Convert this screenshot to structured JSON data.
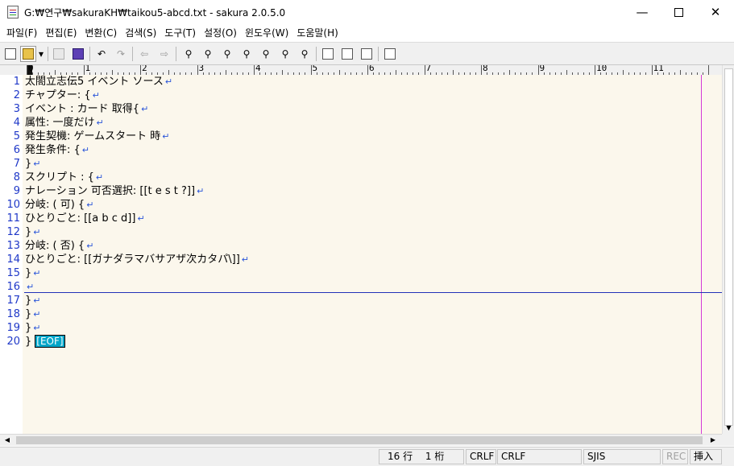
{
  "window": {
    "title": "G:₩연구₩sakuraKH₩taikou5-abcd.txt - sakura 2.0.5.0",
    "minimize": "—",
    "close": "✕"
  },
  "menu": [
    {
      "label": "파일(F)"
    },
    {
      "label": "편집(E)"
    },
    {
      "label": "변환(C)"
    },
    {
      "label": "검색(S)"
    },
    {
      "label": "도구(T)"
    },
    {
      "label": "설정(O)"
    },
    {
      "label": "윈도우(W)"
    },
    {
      "label": "도움말(H)"
    }
  ],
  "toolbar": {
    "icons": [
      "new-file-icon",
      "open-file-icon",
      "dropdown-arrow-icon",
      "save-disabled-icon",
      "save-as-icon",
      "undo-icon",
      "redo-icon",
      "jump-back-icon",
      "jump-forward-icon",
      "search-icon",
      "search-prev-icon",
      "search-next-icon",
      "replace-icon",
      "clear-search-mark-icon",
      "grep-icon",
      "tag-jump-icon",
      "compare-icon",
      "outline-icon",
      "print-icon",
      "properties-icon"
    ]
  },
  "ruler": {
    "labels": [
      "0",
      "1",
      "2",
      "3",
      "4",
      "5",
      "6",
      "7",
      "8",
      "9",
      "10",
      "11"
    ]
  },
  "editor": {
    "lines": [
      {
        "n": "1",
        "text": "太閤立志伝5 イベント ソース",
        "eol": "↵"
      },
      {
        "n": "2",
        "text": "チャプター: {",
        "eol": "↵"
      },
      {
        "n": "3",
        "text": "イベント : カード 取得{",
        "eol": "↵"
      },
      {
        "n": "4",
        "text": "属性: 一度だけ",
        "eol": "↵"
      },
      {
        "n": "5",
        "text": "発生契機: ゲームスタート 時",
        "eol": "↵"
      },
      {
        "n": "6",
        "text": "発生条件: {",
        "eol": "↵"
      },
      {
        "n": "7",
        "text": "}",
        "eol": "↵"
      },
      {
        "n": "8",
        "text": "スクリプト : {",
        "eol": "↵"
      },
      {
        "n": "9",
        "text": "ナレーション 可否選択: [[t e s t ?]]",
        "eol": "↵"
      },
      {
        "n": "10",
        "text": "分岐: ( 可) {",
        "eol": "↵"
      },
      {
        "n": "11",
        "text": "ひとりごと: [[a b c d]]",
        "eol": "↵"
      },
      {
        "n": "12",
        "text": "}",
        "eol": "↵"
      },
      {
        "n": "13",
        "text": "分岐: ( 否) {",
        "eol": "↵"
      },
      {
        "n": "14",
        "text": "ひとりごと: [[ガナダラマバサアザ次カタパ\\]]",
        "eol": "↵"
      },
      {
        "n": "15",
        "text": "}",
        "eol": "↵"
      },
      {
        "n": "16",
        "text": "",
        "eol": "↵"
      },
      {
        "n": "17",
        "text": "}",
        "eol": "↵"
      },
      {
        "n": "18",
        "text": "}",
        "eol": "↵"
      },
      {
        "n": "19",
        "text": "}",
        "eol": "↵"
      },
      {
        "n": "20",
        "text": "}",
        "eof": "[EOF]"
      }
    ]
  },
  "status": {
    "position": "16 行　  1 桁",
    "eol1": "CRLF",
    "eol2": "CRLF",
    "encoding": "SJIS",
    "rec": "REC",
    "mode": "挿入"
  },
  "colors": {
    "editor_bg": "#fbf7ec",
    "line_number": "#1f38c8",
    "eol_mark": "#2a55d9",
    "wrap_line": "#d43ad7",
    "cursor_line": "#2231b8",
    "eof_bg": "#00a5c8"
  }
}
